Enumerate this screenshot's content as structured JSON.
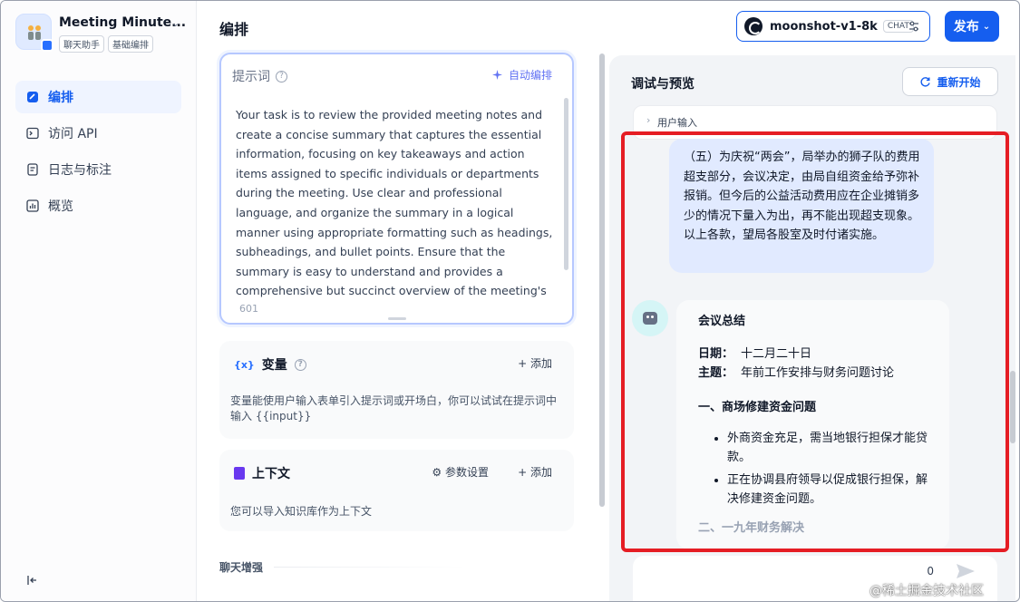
{
  "app": {
    "title": "Meeting Minute...",
    "tags": [
      "聊天助手",
      "基础编排"
    ]
  },
  "sidebar": {
    "items": [
      {
        "label": "编排",
        "icon": "orchestrate-icon",
        "active": true
      },
      {
        "label": "访问 API",
        "icon": "terminal-icon",
        "active": false
      },
      {
        "label": "日志与标注",
        "icon": "log-icon",
        "active": false
      },
      {
        "label": "概览",
        "icon": "chart-icon",
        "active": false
      }
    ]
  },
  "header": {
    "page_title": "编排",
    "model_name": "moonshot-v1-8k",
    "model_tag": "CHAT",
    "publish_label": "发布"
  },
  "prompt": {
    "label": "提示词",
    "auto_label": "自动编排",
    "text": "Your task is to review the provided meeting notes and create a concise summary that captures the essential information, focusing on key takeaways and action items assigned to specific individuals or departments during the meeting. Use clear and professional language, and organize the summary in a logical manner using appropriate formatting such as headings, subheadings, and bullet points. Ensure that the summary is easy to understand and provides a comprehensive but succinct overview of the meeting's",
    "count": "601"
  },
  "variables": {
    "icon_text": "{x}",
    "title": "变量",
    "add_label": "+ 添加",
    "desc": "变量能使用户输入表单引入提示词或开场白，你可以试试在提示词中输入 {{input}}"
  },
  "context": {
    "title": "上下文",
    "param_label": "参数设置",
    "add_label": "+ 添加",
    "desc": "您可以导入知识库作为上下文"
  },
  "enhance": {
    "label": "聊天增强"
  },
  "preview": {
    "title": "调试与预览",
    "restart_label": "重新开始",
    "user_input_label": "用户输入",
    "user_message": "（五）为庆祝“两会”，局举办的狮子队的费用超支部分，会议决定，由局自组资金给予弥补报销。但今后的公益活动费用应在企业摊销多少的情况下量入为出，再不能出现超支现象。以上各款，望局各股室及时付诸实施。",
    "bot": {
      "title": "会议总结",
      "date_key": "日期：",
      "date_val": "十二月二十日",
      "topic_key": "主题：",
      "topic_val": "年前工作安排与财务问题讨论",
      "section1": "一、商场修建资金问题",
      "bullets": [
        "外商资金充足，需当地银行担保才能贷款。",
        "正在协调县府领导以促成银行担保，解决修建资金问题。"
      ],
      "section2": "二、一九年财务解决"
    },
    "input_count": "0"
  },
  "watermark": "@稀土掘金技术社区",
  "colors": {
    "accent": "#155eef",
    "highlight": "#e51d24",
    "user_bubble": "#e1eaff"
  }
}
